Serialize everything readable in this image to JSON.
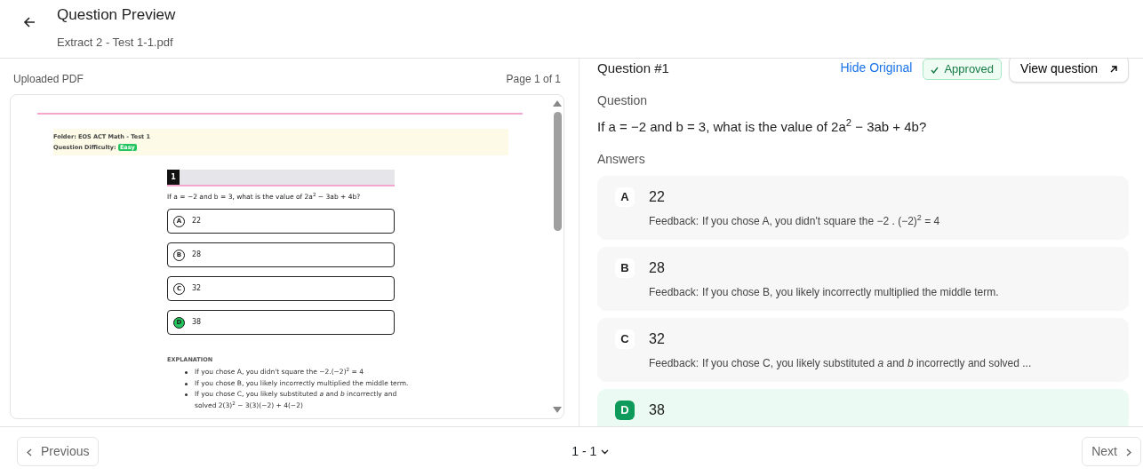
{
  "header": {
    "title": "Question Preview",
    "subtitle": "Extract 2 - Test 1-1.pdf"
  },
  "pdf_panel": {
    "label": "Uploaded PDF",
    "page": "Page 1 of 1",
    "document": {
      "folder": "Folder: EOS ACT Math - Test 1",
      "difficulty_label": "Question Difficulty:",
      "difficulty": "Easy",
      "number": "1",
      "question": "If a = −2 and b = 3, what is the value of 2a$^{2}$ − 3ab + 4b?",
      "options": [
        {
          "letter": "A",
          "text": "22",
          "correct": false
        },
        {
          "letter": "B",
          "text": "28",
          "correct": false
        },
        {
          "letter": "C",
          "text": "32",
          "correct": false
        },
        {
          "letter": "D",
          "text": "38",
          "correct": true
        }
      ],
      "explanation_title": "EXPLANATION",
      "explanation": [
        "If you chose A, you didn't square the −2.(−2)$^{2}$ = 4",
        "If you chose B, you likely incorrectly multiplied the middle term.",
        "If you chose C, you likely substituted *a* and *b* incorrectly and solved 2(3)$^{2}$ − 3(3)(−2) + 4(−2)"
      ]
    }
  },
  "question_panel": {
    "title": "Question #1",
    "hide_link": "Hide Original",
    "status": "Approved",
    "view_button": "View question",
    "question_label": "Question",
    "question": "If a = −2 and b = 3, what is the value of 2a$^{2}$ − 3ab + 4b?",
    "answers_label": "Answers",
    "answers": [
      {
        "letter": "A",
        "value": "22",
        "correct": false,
        "feedback_label": "Feedback:",
        "feedback": "If you chose A, you didn't square the −2 . (−2)$^{2}$ = 4"
      },
      {
        "letter": "B",
        "value": "28",
        "correct": false,
        "feedback_label": "Feedback:",
        "feedback": "If you chose B, you likely incorrectly multiplied the middle term."
      },
      {
        "letter": "C",
        "value": "32",
        "correct": false,
        "feedback_label": "Feedback:",
        "feedback": "If you chose C, you likely substituted *a* and *b* incorrectly and solved ..."
      },
      {
        "letter": "D",
        "value": "38",
        "correct": true
      }
    ]
  },
  "footer": {
    "previous": "Previous",
    "pager": "1 - 1",
    "next": "Next"
  }
}
